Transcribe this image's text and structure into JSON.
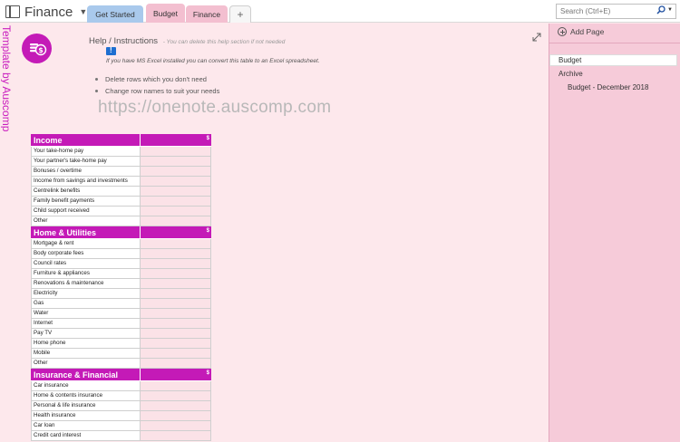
{
  "app": {
    "notebook_title": "Finance",
    "watermark": "Template by Auscomp"
  },
  "tabs": [
    {
      "label": "Get Started",
      "color": "#a9c9ec"
    },
    {
      "label": "Budget",
      "color": "#f3bfd0",
      "active": true
    },
    {
      "label": "Finance",
      "color": "#f3bfd0"
    }
  ],
  "add_tab_label": "+",
  "search": {
    "placeholder": "Search (Ctrl+E)",
    "icon": "magnifier-icon"
  },
  "help": {
    "title": "Help / Instructions",
    "note": "- You can delete this help section if not needed",
    "excel_note": "If you have MS Excel installed you can convert this table to an Excel spreadsheet.",
    "bullets": [
      "Delete rows which you don't need",
      "Change row names to suit your needs"
    ],
    "url": "https://onenote.auscomp.com"
  },
  "budget_table": {
    "currency": "$",
    "sections": [
      {
        "title": "Income",
        "rows": [
          "Your take-home pay",
          "Your partner's take-home pay",
          "Bonuses / overtime",
          "Income from savings and investments",
          "Centrelink benefits",
          "Family benefit payments",
          "Child support received",
          "Other"
        ]
      },
      {
        "title": "Home & Utilities",
        "rows": [
          "Mortgage & rent",
          "Body corporate fees",
          "Council rates",
          "Furniture & appliances",
          "Renovations & maintenance",
          "Electricity",
          "Gas",
          "Water",
          "Internet",
          "Pay TV",
          "Home phone",
          "Mobile",
          "Other"
        ]
      },
      {
        "title": "Insurance & Financial",
        "rows": [
          "Car insurance",
          "Home & contents insurance",
          "Personal & life insurance",
          "Health insurance",
          "Car loan",
          "Credit card interest"
        ]
      }
    ]
  },
  "pages_panel": {
    "add_page_label": "Add Page",
    "pages": [
      {
        "label": "Budget",
        "level": 0,
        "selected": true
      },
      {
        "label": "Archive",
        "level": 0
      },
      {
        "label": "Budget - December 2018",
        "level": 1
      }
    ]
  },
  "colors": {
    "accent": "#c41ab7",
    "page_bg": "#fde8ec",
    "panel_bg": "#f6cbd9"
  }
}
